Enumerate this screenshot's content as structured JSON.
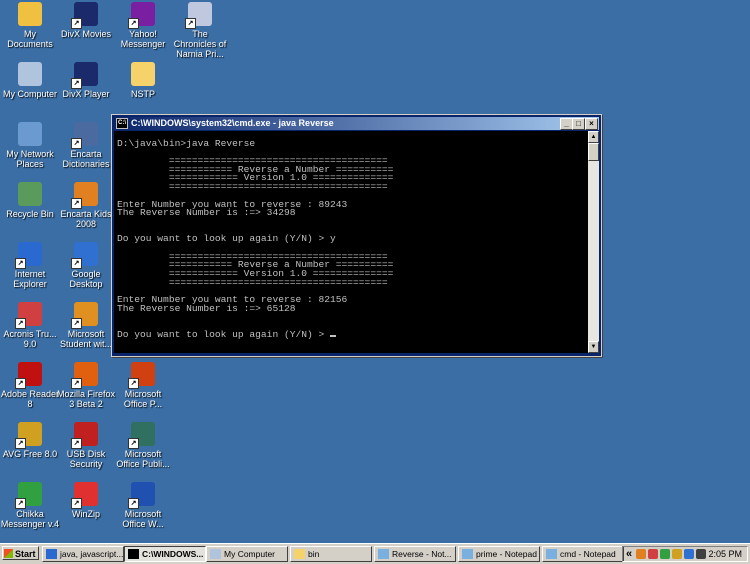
{
  "desktop_icons": [
    {
      "label": "My Documents",
      "icon": "my-documents-icon",
      "color": "#f0c040"
    },
    {
      "label": "DivX Movies",
      "icon": "divx-movies-icon",
      "color": "#1a2a6a"
    },
    {
      "label": "Yahoo! Messenger",
      "icon": "yahoo-messenger-icon",
      "color": "#7b1fa2"
    },
    {
      "label": "The Chronicles of Narnia Pri...",
      "icon": "dvd-icon",
      "color": "#c0c8e0"
    },
    {
      "label": "My Computer",
      "icon": "my-computer-icon",
      "color": "#b0c4de"
    },
    {
      "label": "DivX Player",
      "icon": "divx-player-icon",
      "color": "#1a2a6a"
    },
    {
      "label": "NSTP",
      "icon": "folder-icon",
      "color": "#f5d36a"
    },
    {
      "label": "My Network Places",
      "icon": "network-places-icon",
      "color": "#6a9ad0"
    },
    {
      "label": "Encarta Dictionaries",
      "icon": "encarta-dictionaries-icon",
      "color": "#4a6aa0"
    },
    {
      "label": "Recycle Bin",
      "icon": "recycle-bin-icon",
      "color": "#5a9a5a"
    },
    {
      "label": "Encarta Kids 2008",
      "icon": "encarta-kids-icon",
      "color": "#e08020"
    },
    {
      "label": "Internet Explorer",
      "icon": "internet-explorer-icon",
      "color": "#2a6ad0"
    },
    {
      "label": "Google Desktop",
      "icon": "google-desktop-icon",
      "color": "#3070d0"
    },
    {
      "label": "Acronis Tru... 9.0",
      "icon": "acronis-icon",
      "color": "#d04040"
    },
    {
      "label": "Microsoft Student wit...",
      "icon": "microsoft-student-icon",
      "color": "#e09020"
    },
    {
      "label": "Adobe Reader 8",
      "icon": "adobe-reader-icon",
      "color": "#c01010"
    },
    {
      "label": "Mozilla Firefox 3 Beta 2",
      "icon": "firefox-icon",
      "color": "#e06010"
    },
    {
      "label": "Microsoft Office P...",
      "icon": "powerpoint-icon",
      "color": "#d04010"
    },
    {
      "label": "AVG Free 8.0",
      "icon": "avg-icon",
      "color": "#d0a020"
    },
    {
      "label": "USB Disk Security",
      "icon": "usb-disk-security-icon",
      "color": "#c02020"
    },
    {
      "label": "Microsoft Office Publi...",
      "icon": "publisher-icon",
      "color": "#307060"
    },
    {
      "label": "Chikka Messenger v.4",
      "icon": "chikka-icon",
      "color": "#30a040"
    },
    {
      "label": "WinZip",
      "icon": "winzip-icon",
      "color": "#e03030"
    },
    {
      "label": "Microsoft Office W...",
      "icon": "word-icon",
      "color": "#2050b0"
    }
  ],
  "cmd": {
    "title": "C:\\WINDOWS\\system32\\cmd.exe - java Reverse",
    "lines": [
      "",
      "D:\\java\\bin>java Reverse",
      "",
      "         ======================================",
      "         =========== Reverse a Number ==========",
      "         ============ Version 1.0 ==============",
      "         ======================================",
      "",
      "Enter Number you want to reverse : 89243",
      "The Reverse Number is :=> 34298",
      "",
      "",
      "Do you want to look up again (Y/N) > y",
      "",
      "         ======================================",
      "         =========== Reverse a Number ==========",
      "         ============ Version 1.0 ==============",
      "         ======================================",
      "",
      "Enter Number you want to reverse : 82156",
      "The Reverse Number is :=> 65128",
      "",
      "",
      "Do you want to look up again (Y/N) > "
    ]
  },
  "taskbar": {
    "start_label": "Start",
    "tasks": [
      {
        "label": "java, javascript...",
        "icon": "ie-icon",
        "active": false
      },
      {
        "label": "C:\\WINDOWS...",
        "icon": "cmd-icon",
        "active": true
      },
      {
        "label": "My Computer",
        "icon": "my-computer-icon",
        "active": false
      },
      {
        "label": "bin",
        "icon": "folder-icon",
        "active": false
      },
      {
        "label": "Reverse - Not...",
        "icon": "notepad-icon",
        "active": false
      },
      {
        "label": "prime - Notepad",
        "icon": "notepad-icon",
        "active": false
      },
      {
        "label": "cmd - Notepad",
        "icon": "notepad-icon",
        "active": false
      }
    ],
    "tray_expand": "«",
    "clock": "2:05 PM"
  }
}
